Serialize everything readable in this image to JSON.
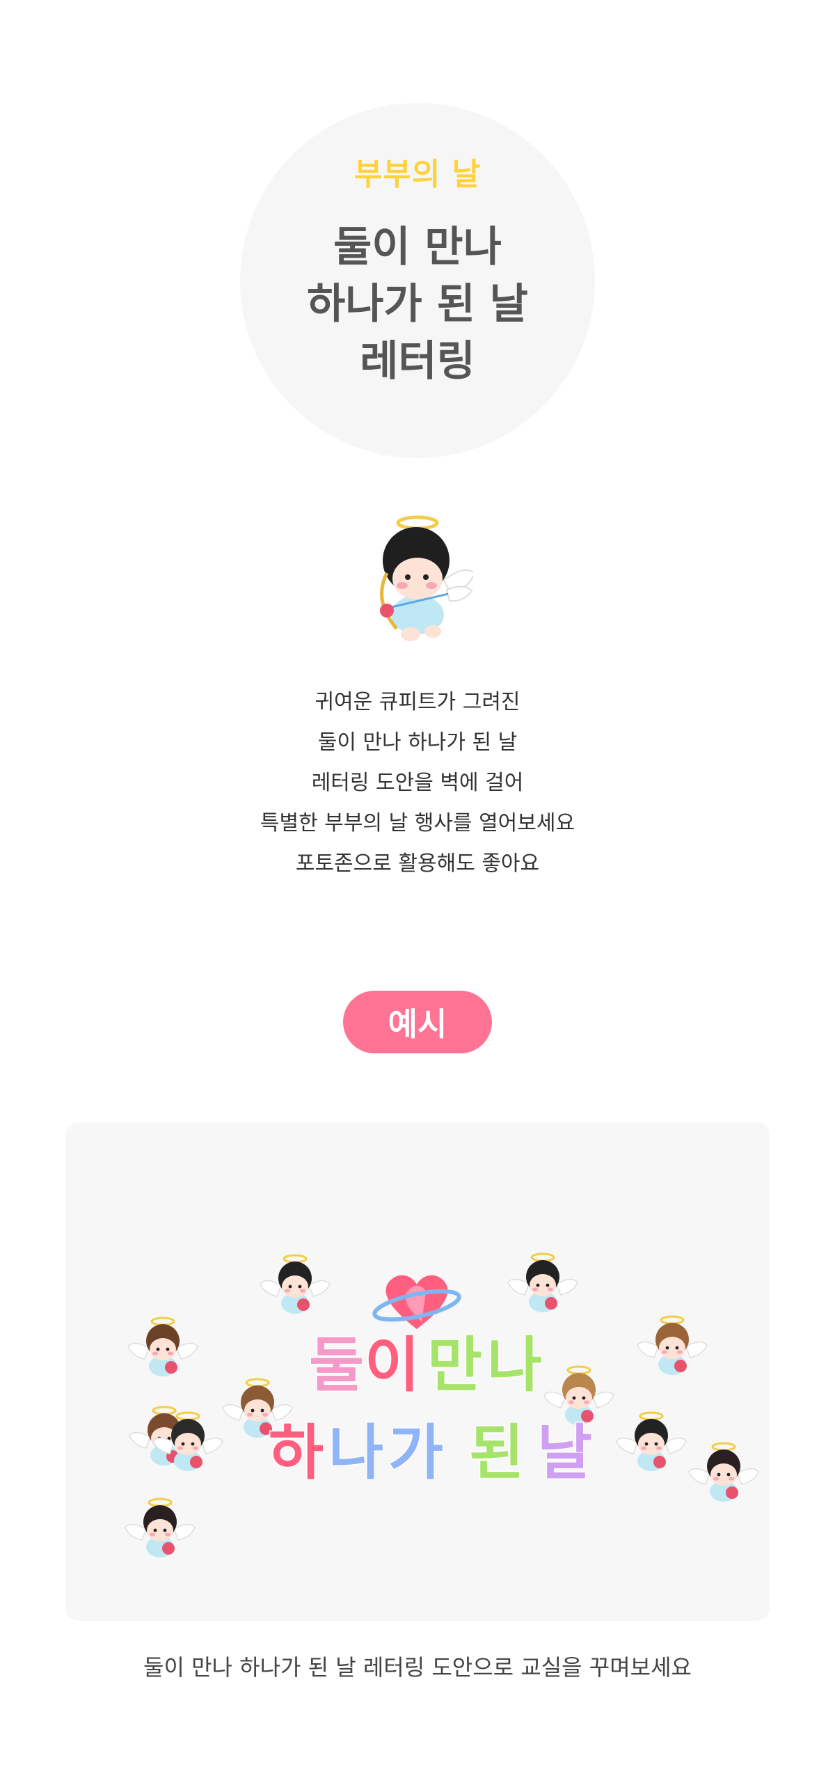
{
  "hero": {
    "subtitle": "부부의 날",
    "title_lines": [
      "둘이 만나",
      "하나가 된 날",
      "레터링"
    ]
  },
  "description": {
    "lines": [
      "귀여운 큐피트가 그려진",
      "둘이 만나 하나가 된 날",
      "레터링 도안을 벽에 걸어",
      "특별한 부부의 날 행사를 열어보세요",
      "포토존으로 활용해도 좋아요"
    ]
  },
  "example": {
    "badge_label": "예시",
    "lettering": {
      "line1": [
        "둘",
        "이",
        "만",
        "나"
      ],
      "line2": [
        "하",
        "나",
        "가",
        "된",
        "날"
      ]
    },
    "caption": "둘이 만나 하나가 된 날 레터링 도안으로 교실을 꾸며보세요"
  },
  "colors": {
    "accent_yellow": "#ffd13b",
    "badge_pink": "#ff7494",
    "panel_bg": "#f7f7f7",
    "circle_bg": "#f6f6f6",
    "letter_pink": "#f59ac8",
    "letter_green": "#a6e36a",
    "letter_blue": "#8fb4f7",
    "letter_purple": "#cfa0f2"
  },
  "icons": [
    "cupid-illustration",
    "heart-planet-icon"
  ]
}
